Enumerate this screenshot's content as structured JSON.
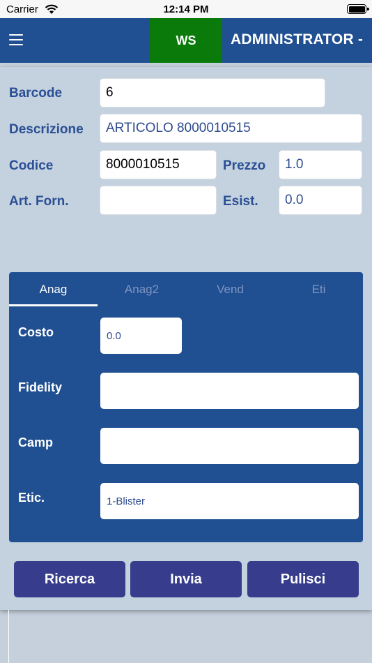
{
  "status_bar": {
    "carrier": "Carrier",
    "time": "12:14 PM"
  },
  "nav": {
    "workstation": "WS",
    "user": "ADMINISTRATOR -"
  },
  "form": {
    "barcode": {
      "label": "Barcode",
      "value": "6"
    },
    "descrizione": {
      "label": "Descrizione",
      "value": "ARTICOLO 8000010515"
    },
    "codice": {
      "label": "Codice",
      "value": "8000010515"
    },
    "prezzo": {
      "label": "Prezzo",
      "value": "1.0"
    },
    "art_forn": {
      "label": "Art. Forn.",
      "value": ""
    },
    "esist": {
      "label": "Esist.",
      "value": "0.0"
    }
  },
  "tabs": [
    {
      "label": "Anag",
      "active": true
    },
    {
      "label": "Anag2",
      "active": false
    },
    {
      "label": "Vend",
      "active": false
    },
    {
      "label": "Eti",
      "active": false
    }
  ],
  "anag": {
    "costo": {
      "label": "Costo",
      "value": "0.0"
    },
    "fidelity": {
      "label": "Fidelity",
      "value": ""
    },
    "camp": {
      "label": "Camp",
      "value": ""
    },
    "etic": {
      "label": "Etic.",
      "value": "1-Blister"
    }
  },
  "actions": {
    "ricerca": "Ricerca",
    "invia": "Invia",
    "pulisci": "Pulisci"
  },
  "colors": {
    "nav": "#204f92",
    "ws_badge": "#0a7b0a",
    "button": "#373d8c",
    "label": "#2a4f95"
  }
}
